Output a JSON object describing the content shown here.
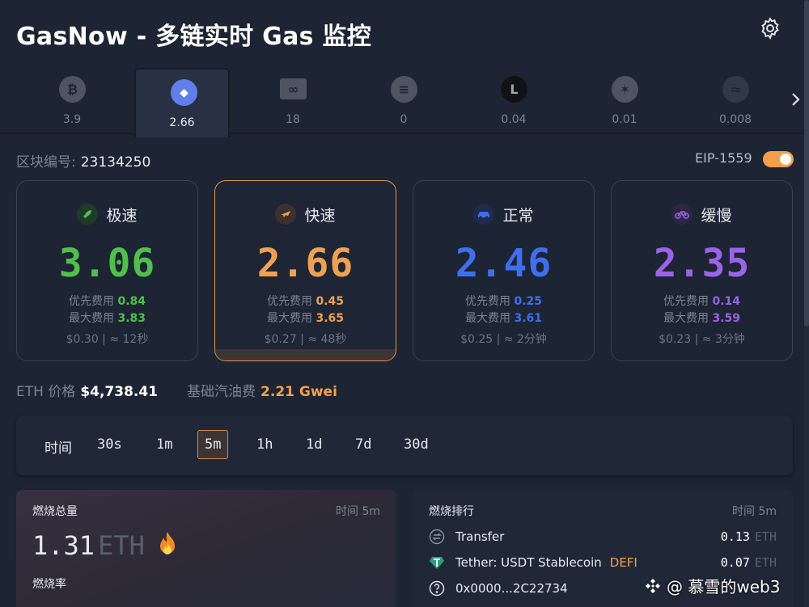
{
  "header": {
    "title": "GasNow - 多链实时 Gas 监控"
  },
  "chains": [
    {
      "name": "btc",
      "value": "3.9",
      "color": "#6b7280",
      "glyph": "₿"
    },
    {
      "name": "eth",
      "value": "2.66",
      "color": "#627eea",
      "glyph": "◆"
    },
    {
      "name": "polygon",
      "value": "18",
      "color": "#6b7280",
      "glyph": "∞"
    },
    {
      "name": "scroll",
      "value": "0",
      "color": "#6b7280",
      "glyph": "≡"
    },
    {
      "name": "linea",
      "value": "0.04",
      "color": "#0b0b0b",
      "glyph": "L"
    },
    {
      "name": "starknet",
      "value": "0.01",
      "color": "#6b7280",
      "glyph": "✶"
    },
    {
      "name": "other",
      "value": "0.008",
      "color": "#3a4152",
      "glyph": "≈"
    }
  ],
  "block": {
    "label": "区块编号:",
    "number": "23134250"
  },
  "eip": {
    "label": "EIP-1559",
    "enabled": true
  },
  "cards": [
    {
      "key": "rapid",
      "label": "极速",
      "gas": "3.06",
      "color": "#4fc04a",
      "icon_color": "#1f3a2a",
      "priority_label": "优先费用",
      "priority": "0.84",
      "max_label": "最大费用",
      "max": "3.83",
      "footer": "$0.30 | ≈ 12秒"
    },
    {
      "key": "fast",
      "label": "快速",
      "gas": "2.66",
      "color": "#f0a14f",
      "icon_color": "#3b3230",
      "priority_label": "优先费用",
      "priority": "0.45",
      "max_label": "最大费用",
      "max": "3.65",
      "footer": "$0.27 | ≈ 48秒"
    },
    {
      "key": "standard",
      "label": "正常",
      "gas": "2.46",
      "color": "#3d6ff0",
      "icon_color": "#202a4a",
      "priority_label": "优先费用",
      "priority": "0.25",
      "max_label": "最大费用",
      "max": "3.61",
      "footer": "$0.25 | ≈ 2分钟"
    },
    {
      "key": "slow",
      "label": "缓慢",
      "gas": "2.35",
      "color": "#9a63e8",
      "icon_color": "#2c2644",
      "priority_label": "优先费用",
      "priority": "0.14",
      "max_label": "最大费用",
      "max": "3.59",
      "footer": "$0.23 | ≈ 3分钟"
    }
  ],
  "price": {
    "eth_label": "ETH 价格",
    "eth_value": "$4,738.41",
    "base_label": "基础汽油费",
    "base_value": "2.21 Gwei"
  },
  "time_filter": {
    "label": "时间",
    "options": [
      "30s",
      "1m",
      "5m",
      "1h",
      "1d",
      "7d",
      "30d"
    ],
    "selected": "5m"
  },
  "burn": {
    "title": "燃烧总量",
    "meta": "时间  5m",
    "value": "1.31",
    "unit": "ETH",
    "rate_label": "燃烧率"
  },
  "rank": {
    "title": "燃烧排行",
    "meta": "时间  5m",
    "items": [
      {
        "name": "Transfer",
        "tag": "",
        "value": "0.13",
        "unit": "ETH",
        "icon": "transfer-icon"
      },
      {
        "name": "Tether: USDT Stablecoin",
        "tag": "DEFI",
        "value": "0.07",
        "unit": "ETH",
        "icon": "tether-icon"
      },
      {
        "name": "0x0000...2C22734",
        "tag": "",
        "value": "",
        "unit": "",
        "icon": "unknown-contract-icon"
      }
    ]
  },
  "watermark": {
    "text": "@ 慕雪的web3"
  }
}
